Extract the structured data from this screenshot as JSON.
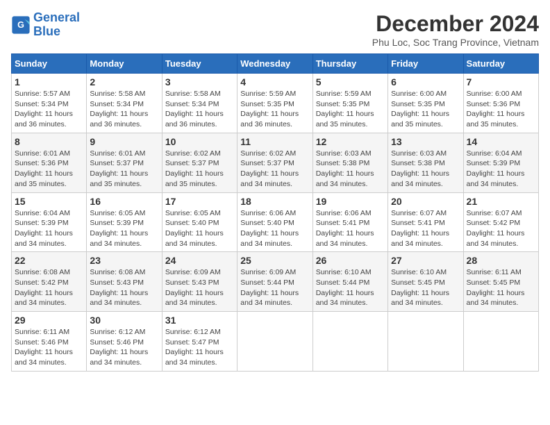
{
  "header": {
    "logo_line1": "General",
    "logo_line2": "Blue",
    "month_title": "December 2024",
    "location": "Phu Loc, Soc Trang Province, Vietnam"
  },
  "days_of_week": [
    "Sunday",
    "Monday",
    "Tuesday",
    "Wednesday",
    "Thursday",
    "Friday",
    "Saturday"
  ],
  "weeks": [
    [
      {
        "day": "1",
        "sunrise": "5:57 AM",
        "sunset": "5:34 PM",
        "daylight": "11 hours and 36 minutes."
      },
      {
        "day": "2",
        "sunrise": "5:58 AM",
        "sunset": "5:34 PM",
        "daylight": "11 hours and 36 minutes."
      },
      {
        "day": "3",
        "sunrise": "5:58 AM",
        "sunset": "5:34 PM",
        "daylight": "11 hours and 36 minutes."
      },
      {
        "day": "4",
        "sunrise": "5:59 AM",
        "sunset": "5:35 PM",
        "daylight": "11 hours and 36 minutes."
      },
      {
        "day": "5",
        "sunrise": "5:59 AM",
        "sunset": "5:35 PM",
        "daylight": "11 hours and 35 minutes."
      },
      {
        "day": "6",
        "sunrise": "6:00 AM",
        "sunset": "5:35 PM",
        "daylight": "11 hours and 35 minutes."
      },
      {
        "day": "7",
        "sunrise": "6:00 AM",
        "sunset": "5:36 PM",
        "daylight": "11 hours and 35 minutes."
      }
    ],
    [
      {
        "day": "8",
        "sunrise": "6:01 AM",
        "sunset": "5:36 PM",
        "daylight": "11 hours and 35 minutes."
      },
      {
        "day": "9",
        "sunrise": "6:01 AM",
        "sunset": "5:37 PM",
        "daylight": "11 hours and 35 minutes."
      },
      {
        "day": "10",
        "sunrise": "6:02 AM",
        "sunset": "5:37 PM",
        "daylight": "11 hours and 35 minutes."
      },
      {
        "day": "11",
        "sunrise": "6:02 AM",
        "sunset": "5:37 PM",
        "daylight": "11 hours and 34 minutes."
      },
      {
        "day": "12",
        "sunrise": "6:03 AM",
        "sunset": "5:38 PM",
        "daylight": "11 hours and 34 minutes."
      },
      {
        "day": "13",
        "sunrise": "6:03 AM",
        "sunset": "5:38 PM",
        "daylight": "11 hours and 34 minutes."
      },
      {
        "day": "14",
        "sunrise": "6:04 AM",
        "sunset": "5:39 PM",
        "daylight": "11 hours and 34 minutes."
      }
    ],
    [
      {
        "day": "15",
        "sunrise": "6:04 AM",
        "sunset": "5:39 PM",
        "daylight": "11 hours and 34 minutes."
      },
      {
        "day": "16",
        "sunrise": "6:05 AM",
        "sunset": "5:39 PM",
        "daylight": "11 hours and 34 minutes."
      },
      {
        "day": "17",
        "sunrise": "6:05 AM",
        "sunset": "5:40 PM",
        "daylight": "11 hours and 34 minutes."
      },
      {
        "day": "18",
        "sunrise": "6:06 AM",
        "sunset": "5:40 PM",
        "daylight": "11 hours and 34 minutes."
      },
      {
        "day": "19",
        "sunrise": "6:06 AM",
        "sunset": "5:41 PM",
        "daylight": "11 hours and 34 minutes."
      },
      {
        "day": "20",
        "sunrise": "6:07 AM",
        "sunset": "5:41 PM",
        "daylight": "11 hours and 34 minutes."
      },
      {
        "day": "21",
        "sunrise": "6:07 AM",
        "sunset": "5:42 PM",
        "daylight": "11 hours and 34 minutes."
      }
    ],
    [
      {
        "day": "22",
        "sunrise": "6:08 AM",
        "sunset": "5:42 PM",
        "daylight": "11 hours and 34 minutes."
      },
      {
        "day": "23",
        "sunrise": "6:08 AM",
        "sunset": "5:43 PM",
        "daylight": "11 hours and 34 minutes."
      },
      {
        "day": "24",
        "sunrise": "6:09 AM",
        "sunset": "5:43 PM",
        "daylight": "11 hours and 34 minutes."
      },
      {
        "day": "25",
        "sunrise": "6:09 AM",
        "sunset": "5:44 PM",
        "daylight": "11 hours and 34 minutes."
      },
      {
        "day": "26",
        "sunrise": "6:10 AM",
        "sunset": "5:44 PM",
        "daylight": "11 hours and 34 minutes."
      },
      {
        "day": "27",
        "sunrise": "6:10 AM",
        "sunset": "5:45 PM",
        "daylight": "11 hours and 34 minutes."
      },
      {
        "day": "28",
        "sunrise": "6:11 AM",
        "sunset": "5:45 PM",
        "daylight": "11 hours and 34 minutes."
      }
    ],
    [
      {
        "day": "29",
        "sunrise": "6:11 AM",
        "sunset": "5:46 PM",
        "daylight": "11 hours and 34 minutes."
      },
      {
        "day": "30",
        "sunrise": "6:12 AM",
        "sunset": "5:46 PM",
        "daylight": "11 hours and 34 minutes."
      },
      {
        "day": "31",
        "sunrise": "6:12 AM",
        "sunset": "5:47 PM",
        "daylight": "11 hours and 34 minutes."
      },
      null,
      null,
      null,
      null
    ]
  ]
}
